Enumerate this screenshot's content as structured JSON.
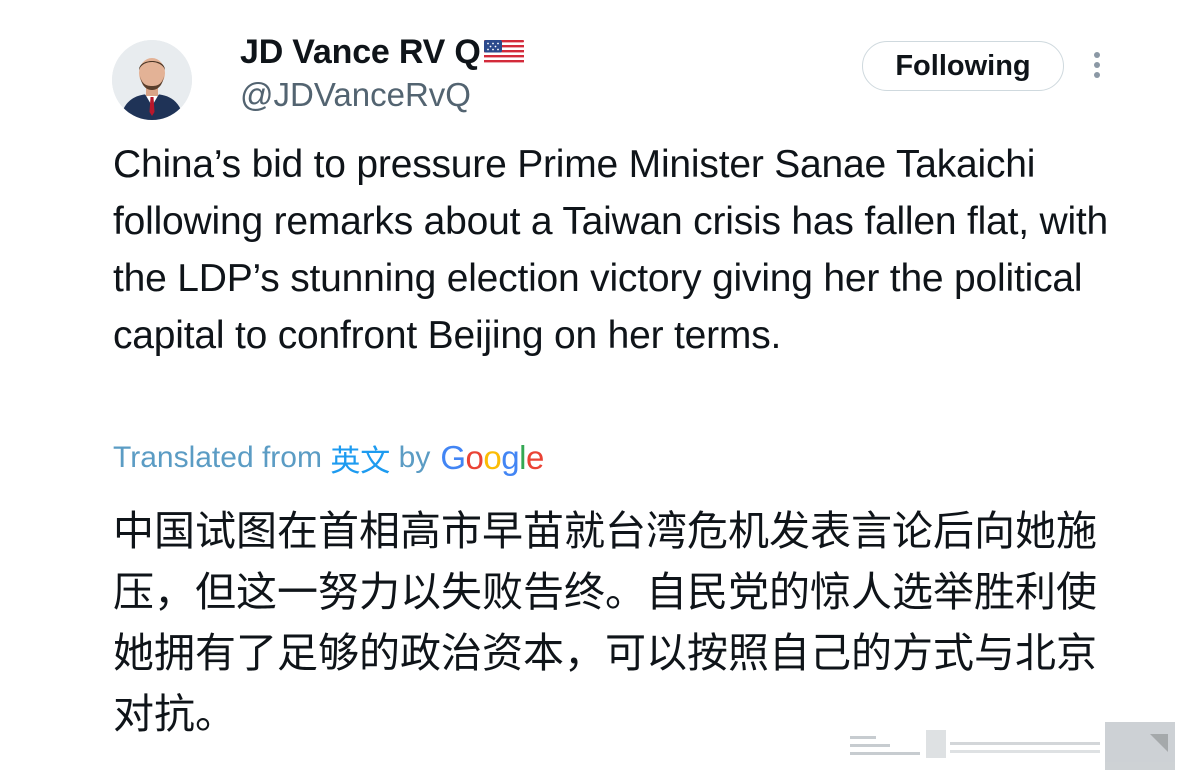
{
  "author": {
    "display_name": "JD Vance RV Q",
    "flag_icon": "us-flag-icon",
    "handle": "@JDVanceRvQ"
  },
  "actions": {
    "follow_label": "Following",
    "more_icon": "more-vertical-icon"
  },
  "tweet": {
    "text": "China’s bid to pressure Prime Minister Sanae Takaichi following remarks about a Taiwan crisis has fallen flat, with the LDP’s stunning election victory giving her the political capital to confront Beijing on her terms."
  },
  "translation": {
    "prefix": "Translated from",
    "language": "英文",
    "by": "by",
    "provider": "Google",
    "text": "中国试图在首相高市早苗就台湾危机发表言论后向她施压，但这一努力以失败告终。自民党的惊人选举胜利使她拥有了足够的政治资本，可以按照自己的方式与北京对抗。"
  },
  "colors": {
    "link_blue": "#1d9bf0",
    "text": "#0f1419",
    "secondary": "#536471",
    "border": "#cfd9de"
  }
}
